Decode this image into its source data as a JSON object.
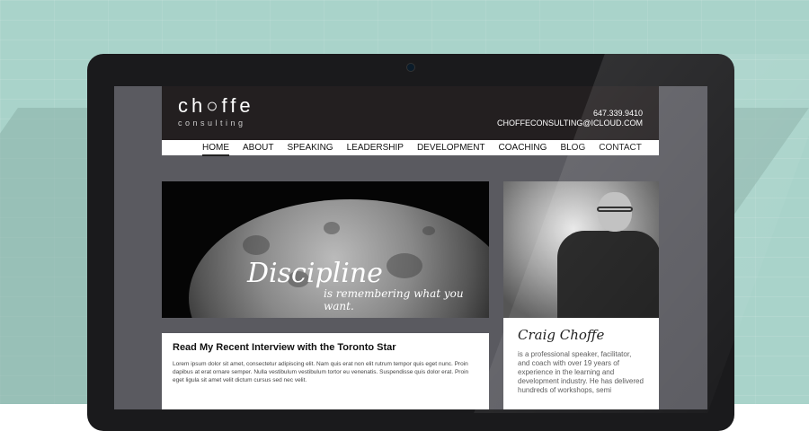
{
  "site": {
    "logo_main": "ch○ffe",
    "logo_sub": "consulting",
    "phone": "647.339.9410",
    "email": "CHOFFECONSULTING@ICLOUD.COM"
  },
  "nav": {
    "items": [
      "HOME",
      "ABOUT",
      "SPEAKING",
      "LEADERSHIP",
      "DEVELOPMENT",
      "COACHING",
      "BLOG",
      "CONTACT"
    ],
    "active": "HOME"
  },
  "hero": {
    "quote_main": "Discipline",
    "quote_sub": "is remembering what you want."
  },
  "article": {
    "title": "Read My Recent Interview with the Toronto Star",
    "body": "Lorem ipsum dolor sit amet, consectetur adipiscing elit. Nam quis erat non elit rutrum tempor quis eget nunc. Proin dapibus at erat ornare semper. Nulla vestibulum vestibulum tortor eu venenatis. Suspendisse quis dolor erat. Proin eget ligula sit amet velit dictum cursus sed nec velit."
  },
  "bio": {
    "name": "Craig Choffe",
    "text": "is a professional speaker, facilitator, and coach with over 19 years of experience in the learning and development industry. He has delivered hundreds of workshops, semi"
  },
  "colors": {
    "wall": "#a9d3ca",
    "header": "#231f20",
    "screen_bg": "#5a5a60"
  }
}
